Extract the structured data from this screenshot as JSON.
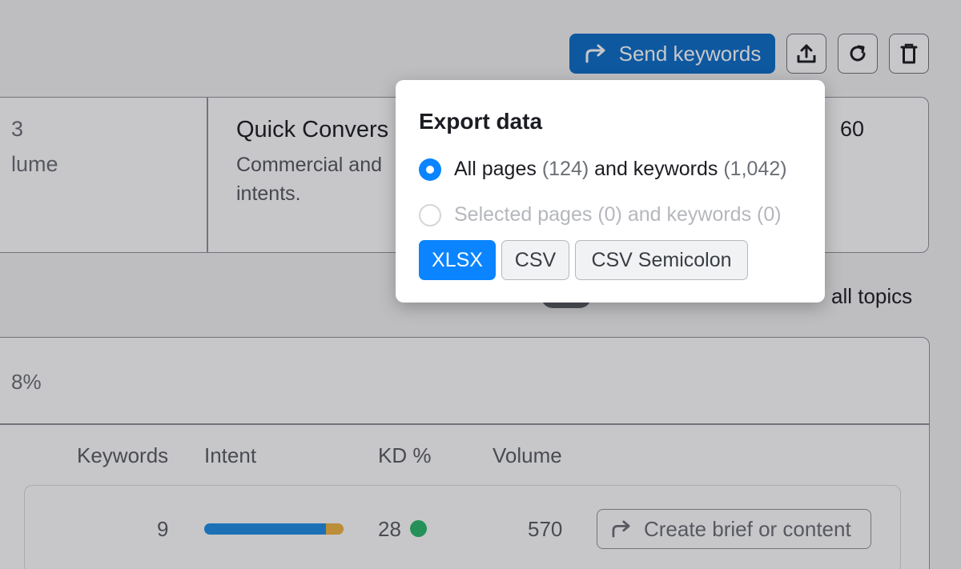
{
  "toolbar": {
    "send_keywords": "Send keywords",
    "icons": [
      "share-arrow-icon",
      "export-icon",
      "refresh-icon",
      "trash-icon"
    ]
  },
  "background": {
    "left_fragment_number": "3",
    "left_fragment_label": "lume",
    "card_title": "Quick Convers",
    "card_desc_line1": "Commercial and",
    "card_desc_line2": "intents.",
    "right_value_fragment": "60",
    "topics_label": "all topics",
    "percent_fragment": "8%",
    "columns": {
      "keywords": "Keywords",
      "intent": "Intent",
      "kd": "KD %",
      "volume": "Volume"
    },
    "row": {
      "keywords": "9",
      "kd": "28",
      "volume": "570",
      "action": "Create brief or content"
    }
  },
  "popup": {
    "title": "Export data",
    "option1": {
      "pages_label": "All pages",
      "pages_count": "(124)",
      "and_keywords": "and keywords",
      "keywords_count": "(1,042)"
    },
    "option2": {
      "pages_label": "Selected pages",
      "pages_count": "(0)",
      "and_keywords": "and keywords",
      "keywords_count": "(0)"
    },
    "formats": [
      "XLSX",
      "CSV",
      "CSV Semicolon"
    ],
    "selected_format": "XLSX"
  },
  "colors": {
    "primary": "#0a84ff",
    "send_button": "#0d6ec9",
    "kd_dot": "#2bb86c"
  }
}
